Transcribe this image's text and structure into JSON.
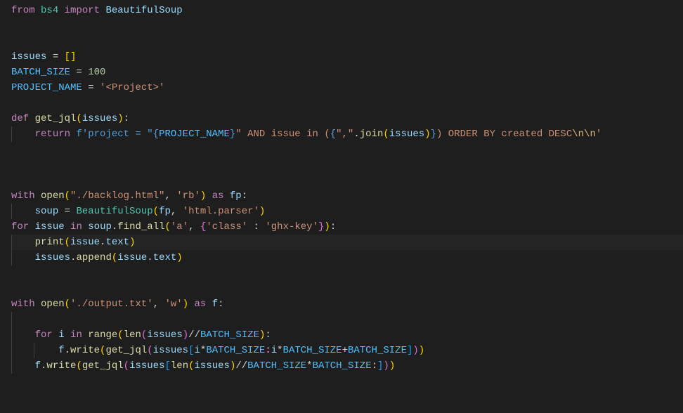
{
  "code": {
    "l1_from": "from",
    "l1_bs4": "bs4",
    "l1_import": "import",
    "l1_Beautiful": "BeautifulSoup",
    "l4_issues": "issues",
    "l4_eq": " = ",
    "l4_lb": "[",
    "l4_rb": "]",
    "l5_BATCH": "BATCH_SIZE",
    "l5_eq": " = ",
    "l5_val": "100",
    "l6_PROJ": "PROJECT_NAME",
    "l6_eq": " = ",
    "l6_val": "'<Project>'",
    "l8_def": "def",
    "l8_fn": "get_jql",
    "l8_lp": "(",
    "l8_param": "issues",
    "l8_rp": ")",
    "l8_colon": ":",
    "l9_return": "return",
    "l9_f": "f'project = \"",
    "l9_ex1l": "{",
    "l9_ex1": "PROJECT_NAME",
    "l9_ex1r": "}",
    "l9_mid": "\" AND issue in (",
    "l9_ex2l": "{",
    "l9_comma_str": "\",\"",
    "l9_dot": ".",
    "l9_join": "join",
    "l9_jlp": "(",
    "l9_jarg": "issues",
    "l9_jrp": ")",
    "l9_ex2r": "}",
    "l9_end": ") ORDER BY created DESC",
    "l9_nl": "\\n\\n",
    "l9_close": "'",
    "l13_with": "with",
    "l13_open": "open",
    "l13_lp": "(",
    "l13_path": "\"./backlog.html\"",
    "l13_c": ", ",
    "l13_mode": "'rb'",
    "l13_rp": ")",
    "l13_as": "as",
    "l13_fp": "fp",
    "l13_colon": ":",
    "l14_soup": "soup",
    "l14_eq": " = ",
    "l14_BS": "BeautifulSoup",
    "l14_lp": "(",
    "l14_fp": "fp",
    "l14_c": ", ",
    "l14_parser": "'html.parser'",
    "l14_rp": ")",
    "l15_for": "for",
    "l15_issue": "issue",
    "l15_in": "in",
    "l15_soup": "soup",
    "l15_dot": ".",
    "l15_findall": "find_all",
    "l15_lp": "(",
    "l15_a": "'a'",
    "l15_c": ", ",
    "l15_lb": "{",
    "l15_k": "'class'",
    "l15_colon2": " : ",
    "l15_v": "'ghx-key'",
    "l15_rb": "}",
    "l15_rp": ")",
    "l15_colon": ":",
    "l16_print": "print",
    "l16_lp": "(",
    "l16_issue": "issue",
    "l16_dot": ".",
    "l16_text": "text",
    "l16_rp": ")",
    "l17_issues": "issues",
    "l17_dot": ".",
    "l17_append": "append",
    "l17_lp": "(",
    "l17_issue": "issue",
    "l17_dot2": ".",
    "l17_text": "text",
    "l17_rp": ")",
    "l20_with": "with",
    "l20_open": "open",
    "l20_lp": "(",
    "l20_path": "'./output.txt'",
    "l20_c": ", ",
    "l20_mode": "'w'",
    "l20_rp": ")",
    "l20_as": "as",
    "l20_f": "f",
    "l20_colon": ":",
    "l22_for": "for",
    "l22_i": "i",
    "l22_in": "in",
    "l22_range": "range",
    "l22_lp": "(",
    "l22_len": "len",
    "l22_lp2": "(",
    "l22_issues": "issues",
    "l22_rp2": ")",
    "l22_div": "//",
    "l22_BATCH": "BATCH_SIZE",
    "l22_rp": ")",
    "l22_colon": ":",
    "l23_f": "f",
    "l23_dot": ".",
    "l23_write": "write",
    "l23_lp": "(",
    "l23_getjql": "get_jql",
    "l23_lp2": "(",
    "l23_issues": "issues",
    "l23_lb": "[",
    "l23_i1": "i",
    "l23_mul1": "*",
    "l23_B1": "BATCH_SIZE",
    "l23_slice": ":",
    "l23_i2": "i",
    "l23_mul2": "*",
    "l23_B2": "BATCH_SIZE",
    "l23_plus": "+",
    "l23_B3": "BATCH_SIZE",
    "l23_rb": "]",
    "l23_rp2": ")",
    "l23_rp": ")",
    "l24_f": "f",
    "l24_dot": ".",
    "l24_write": "write",
    "l24_lp": "(",
    "l24_getjql": "get_jql",
    "l24_lp2": "(",
    "l24_issues": "issues",
    "l24_lb": "[",
    "l24_len": "len",
    "l24_lp3": "(",
    "l24_issues2": "issues",
    "l24_rp3": ")",
    "l24_div": "//",
    "l24_B1": "BATCH_SIZE",
    "l24_mul": "*",
    "l24_B2": "BATCH_SIZE",
    "l24_slice": ":",
    "l24_rb": "]",
    "l24_rp2": ")",
    "l24_rp": ")"
  }
}
